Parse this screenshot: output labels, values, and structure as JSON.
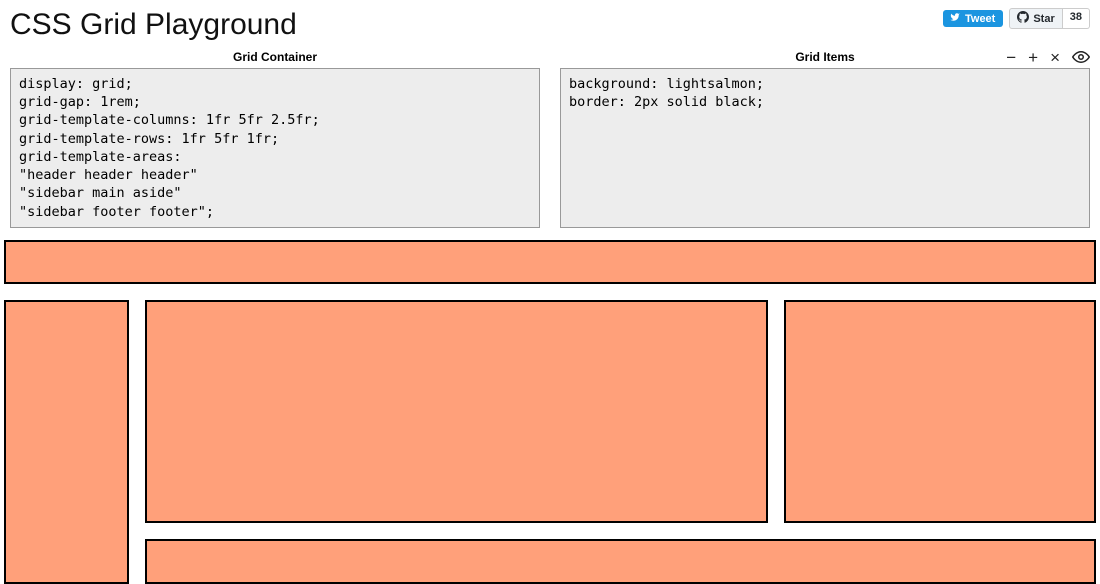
{
  "header": {
    "title": "CSS Grid Playground",
    "tweet_label": "Tweet",
    "star_label": "Star",
    "star_count": "38"
  },
  "editors": {
    "container": {
      "label": "Grid Container",
      "code": "display: grid;\ngrid-gap: 1rem;\ngrid-template-columns: 1fr 5fr 2.5fr;\ngrid-template-rows: 1fr 5fr 1fr;\ngrid-template-areas:\n\"header header header\"\n\"sidebar main aside\"\n\"sidebar footer footer\";"
    },
    "items": {
      "label": "Grid Items",
      "code": "background: lightsalmon;\nborder: 2px solid black;"
    }
  },
  "controls": {
    "minus": "−",
    "plus": "+",
    "close": "×"
  },
  "colors": {
    "item_bg": "lightsalmon",
    "item_border": "black",
    "tweet_bg": "#1b95e0"
  }
}
